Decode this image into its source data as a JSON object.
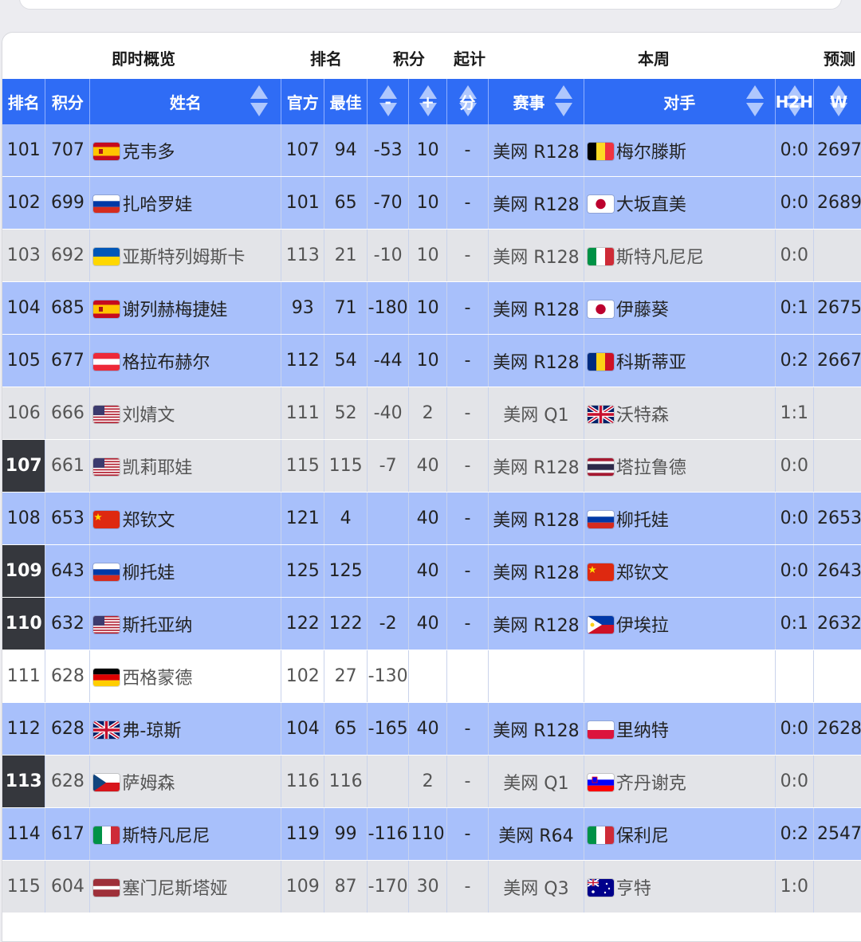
{
  "groups": {
    "overview": "即时概览",
    "rank": "排名",
    "points": "积分",
    "start": "起计",
    "week": "本周",
    "predict": "预测"
  },
  "columns": {
    "rank": "排名",
    "points": "积分",
    "name": "姓名",
    "official": "官方",
    "best": "最佳",
    "minus": "-",
    "plus": "+",
    "pts": "分",
    "event": "赛事",
    "opponent": "对手",
    "h2h": "H2H",
    "w": "W"
  },
  "rows": [
    {
      "rank": "101",
      "points": "707",
      "flag": "spain",
      "name": "克韦多",
      "official": "107",
      "best": "94",
      "minus": "-53",
      "plus": "10",
      "pts": "-",
      "event": "美网 R128",
      "opp_flag": "belgium",
      "opponent": "梅尔滕斯",
      "h2h": "0:0",
      "w": "2697",
      "style": "blue",
      "dark": false
    },
    {
      "rank": "102",
      "points": "699",
      "flag": "russia",
      "name": "扎哈罗娃",
      "official": "101",
      "best": "65",
      "minus": "-70",
      "plus": "10",
      "pts": "-",
      "event": "美网 R128",
      "opp_flag": "japan",
      "opponent": "大坂直美",
      "h2h": "0:0",
      "w": "2689",
      "style": "blue",
      "dark": false
    },
    {
      "rank": "103",
      "points": "692",
      "flag": "ukraine",
      "name": "亚斯特列姆斯卡",
      "official": "113",
      "best": "21",
      "minus": "-10",
      "plus": "10",
      "pts": "-",
      "event": "美网 R128",
      "opp_flag": "italy",
      "opponent": "斯特凡尼尼",
      "h2h": "0:0",
      "w": "",
      "style": "gray",
      "dark": false
    },
    {
      "rank": "104",
      "points": "685",
      "flag": "spain",
      "name": "谢列赫梅捷娃",
      "official": "93",
      "best": "71",
      "minus": "-180",
      "plus": "10",
      "pts": "-",
      "event": "美网 R128",
      "opp_flag": "japan",
      "opponent": "伊藤葵",
      "h2h": "0:1",
      "w": "2675",
      "style": "blue",
      "dark": false
    },
    {
      "rank": "105",
      "points": "677",
      "flag": "austria",
      "name": "格拉布赫尔",
      "official": "112",
      "best": "54",
      "minus": "-44",
      "plus": "10",
      "pts": "-",
      "event": "美网 R128",
      "opp_flag": "romania",
      "opponent": "科斯蒂亚",
      "h2h": "0:2",
      "w": "2667",
      "style": "blue",
      "dark": false
    },
    {
      "rank": "106",
      "points": "666",
      "flag": "usa",
      "name": "刘婧文",
      "official": "111",
      "best": "52",
      "minus": "-40",
      "plus": "2",
      "pts": "-",
      "event": "美网 Q1",
      "opp_flag": "uk",
      "opponent": "沃特森",
      "h2h": "1:1",
      "w": "",
      "style": "gray",
      "dark": false
    },
    {
      "rank": "107",
      "points": "661",
      "flag": "usa",
      "name": "凯莉耶娃",
      "official": "115",
      "best": "115",
      "minus": "-7",
      "plus": "40",
      "pts": "-",
      "event": "美网 R128",
      "opp_flag": "thailand",
      "opponent": "塔拉鲁德",
      "h2h": "0:0",
      "w": "",
      "style": "gray",
      "dark": true
    },
    {
      "rank": "108",
      "points": "653",
      "flag": "china",
      "name": "郑钦文",
      "official": "121",
      "best": "4",
      "minus": "",
      "plus": "40",
      "pts": "-",
      "event": "美网 R128",
      "opp_flag": "russia",
      "opponent": "柳托娃",
      "h2h": "0:0",
      "w": "2653",
      "style": "blue",
      "dark": false
    },
    {
      "rank": "109",
      "points": "643",
      "flag": "russia",
      "name": "柳托娃",
      "official": "125",
      "best": "125",
      "minus": "",
      "plus": "40",
      "pts": "-",
      "event": "美网 R128",
      "opp_flag": "china",
      "opponent": "郑钦文",
      "h2h": "0:0",
      "w": "2643",
      "style": "blue",
      "dark": true
    },
    {
      "rank": "110",
      "points": "632",
      "flag": "usa",
      "name": "斯托亚纳",
      "official": "122",
      "best": "122",
      "minus": "-2",
      "plus": "40",
      "pts": "-",
      "event": "美网 R128",
      "opp_flag": "philippines",
      "opponent": "伊埃拉",
      "h2h": "0:1",
      "w": "2632",
      "style": "blue",
      "dark": true
    },
    {
      "rank": "111",
      "points": "628",
      "flag": "germany",
      "name": "西格蒙德",
      "official": "102",
      "best": "27",
      "minus": "-130",
      "plus": "",
      "pts": "",
      "event": "",
      "opp_flag": "",
      "opponent": "",
      "h2h": "",
      "w": "",
      "style": "white",
      "dark": false
    },
    {
      "rank": "112",
      "points": "628",
      "flag": "uk",
      "name": "弗-琼斯",
      "official": "104",
      "best": "65",
      "minus": "-165",
      "plus": "40",
      "pts": "-",
      "event": "美网 R128",
      "opp_flag": "poland",
      "opponent": "里纳特",
      "h2h": "0:0",
      "w": "2628",
      "style": "blue",
      "dark": false
    },
    {
      "rank": "113",
      "points": "628",
      "flag": "czech",
      "name": "萨姆森",
      "official": "116",
      "best": "116",
      "minus": "",
      "plus": "2",
      "pts": "-",
      "event": "美网 Q1",
      "opp_flag": "slovenia",
      "opponent": "齐丹谢克",
      "h2h": "0:0",
      "w": "",
      "style": "gray",
      "dark": true
    },
    {
      "rank": "114",
      "points": "617",
      "flag": "italy",
      "name": "斯特凡尼尼",
      "official": "119",
      "best": "99",
      "minus": "-116",
      "plus": "110",
      "pts": "-",
      "event": "美网 R64",
      "opp_flag": "italy",
      "opponent": "保利尼",
      "h2h": "0:2",
      "w": "2547",
      "style": "blue",
      "dark": false
    },
    {
      "rank": "115",
      "points": "604",
      "flag": "latvia",
      "name": "塞门尼斯塔娅",
      "official": "109",
      "best": "87",
      "minus": "-170",
      "plus": "30",
      "pts": "-",
      "event": "美网 Q3",
      "opp_flag": "australia",
      "opponent": "亨特",
      "h2h": "1:0",
      "w": "",
      "style": "gray",
      "dark": false
    }
  ],
  "colors": {
    "header": "#2f6cf5",
    "row_blue": "#a8c0fb",
    "row_gray": "#e3e4e8",
    "rank_dark": "#35373d"
  }
}
